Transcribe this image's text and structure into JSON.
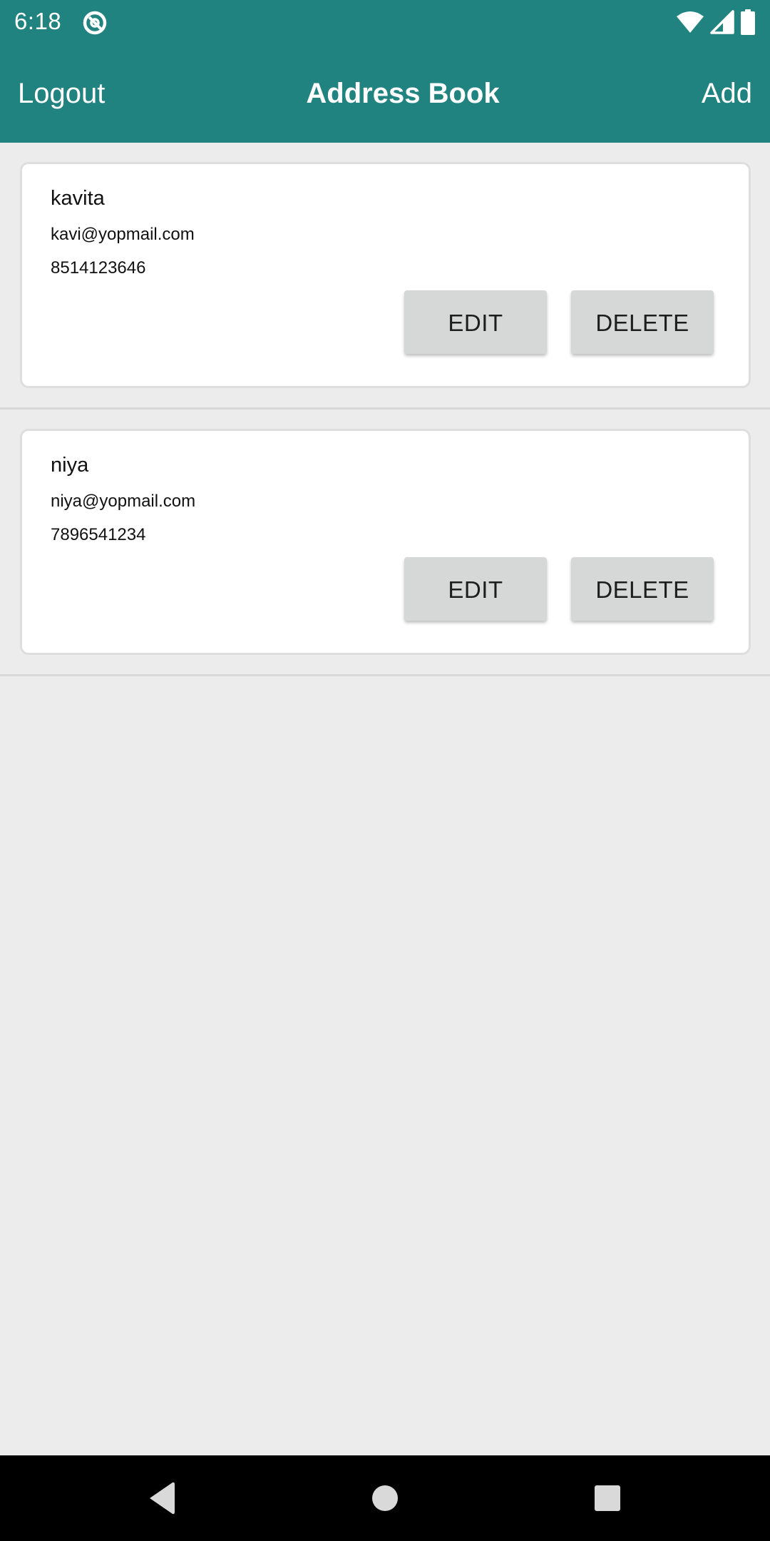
{
  "status_bar": {
    "time": "6:18",
    "icons": [
      "app-notification-icon",
      "wifi-icon",
      "cellular-signal-icon",
      "battery-icon"
    ]
  },
  "app_bar": {
    "left_action": "Logout",
    "title": "Address Book",
    "right_action": "Add",
    "background_color": "#218380"
  },
  "contacts": [
    {
      "name": "kavita",
      "email": "kavi@yopmail.com",
      "phone": "8514123646",
      "edit_label": "EDIT",
      "delete_label": "DELETE"
    },
    {
      "name": "niya",
      "email": "niya@yopmail.com",
      "phone": "7896541234",
      "edit_label": "EDIT",
      "delete_label": "DELETE"
    }
  ],
  "nav_bar": {
    "icons": [
      "back-icon",
      "home-icon",
      "recents-icon"
    ]
  }
}
